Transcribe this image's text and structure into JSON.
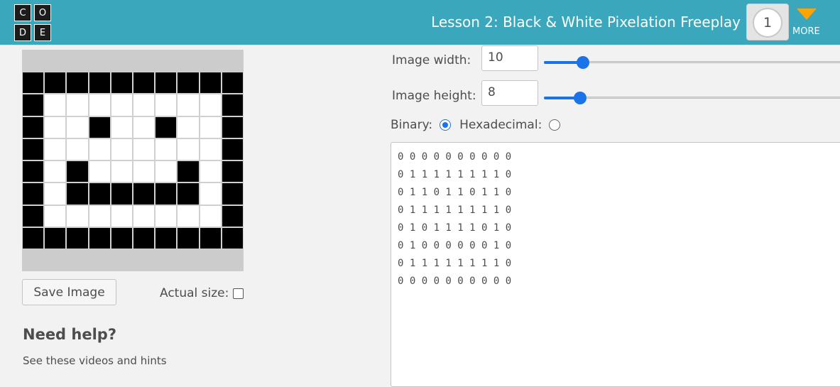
{
  "header": {
    "logo_letters": [
      "C",
      "O",
      "D",
      "E"
    ],
    "lesson_title": "Lesson 2: Black & White Pixelation Freeplay",
    "progress_level": "1",
    "more_label": "MORE",
    "more_icon": "chevron-down-icon",
    "colors": {
      "bar": "#3aa7bd",
      "more_arrow": "#ffa400"
    }
  },
  "image": {
    "width": "10",
    "height": "8",
    "width_slider_fraction": 0.035,
    "height_slider_fraction": 0.025,
    "pixels": [
      [
        1,
        1,
        1,
        1,
        1,
        1,
        1,
        1,
        1,
        1
      ],
      [
        1,
        0,
        0,
        0,
        0,
        0,
        0,
        0,
        0,
        1
      ],
      [
        1,
        0,
        0,
        1,
        0,
        0,
        1,
        0,
        0,
        1
      ],
      [
        1,
        0,
        0,
        0,
        0,
        0,
        0,
        0,
        0,
        1
      ],
      [
        1,
        0,
        1,
        0,
        0,
        0,
        0,
        1,
        0,
        1
      ],
      [
        1,
        0,
        1,
        1,
        1,
        1,
        1,
        1,
        0,
        1
      ],
      [
        1,
        0,
        0,
        0,
        0,
        0,
        0,
        0,
        0,
        1
      ],
      [
        1,
        1,
        1,
        1,
        1,
        1,
        1,
        1,
        1,
        1
      ]
    ]
  },
  "controls": {
    "save_label": "Save Image",
    "actual_size_label": "Actual size:",
    "actual_size_checked": false,
    "width_label": "Image width:",
    "height_label": "Image height:",
    "binary_label": "Binary:",
    "hex_label": "Hexadecimal:",
    "selected_format": "binary"
  },
  "binary_lines": [
    "0 0 0 0 0 0 0 0 0 0",
    "0 1 1 1 1 1 1 1 1 0",
    "0 1 1 0 1 1 0 1 1 0",
    "0 1 1 1 1 1 1 1 1 0",
    "0 1 0 1 1 1 1 0 1 0",
    "0 1 0 0 0 0 0 0 1 0",
    "0 1 1 1 1 1 1 1 1 0",
    "0 0 0 0 0 0 0 0 0 0"
  ],
  "help": {
    "title": "Need help?",
    "subtitle": "See these videos and hints"
  }
}
